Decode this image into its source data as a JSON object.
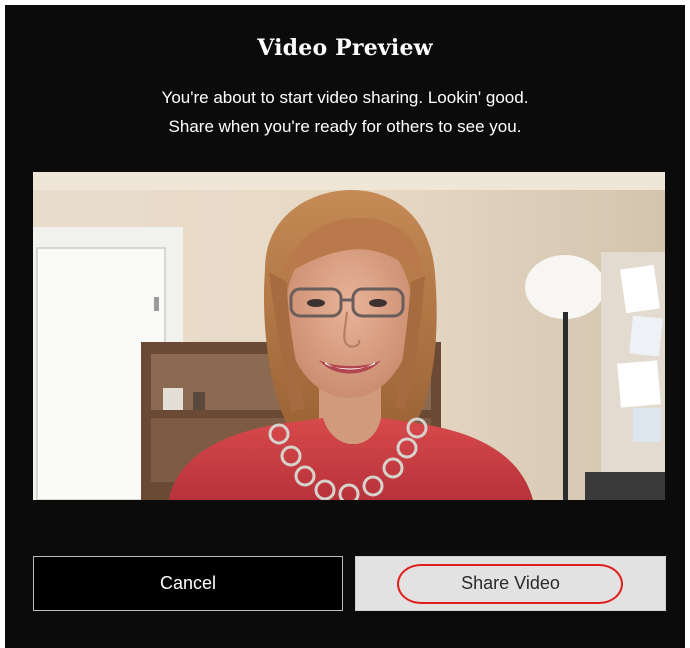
{
  "dialog": {
    "title": "Video Preview",
    "message_line1": "You're about to start video sharing. Lookin' good.",
    "message_line2": "Share when you're ready for others to see you."
  },
  "buttons": {
    "cancel_label": "Cancel",
    "share_label": "Share Video"
  },
  "colors": {
    "background": "#0b0b0b",
    "text": "#ffffff",
    "cancel_border": "#bdbdbd",
    "share_background": "#e2e2e2",
    "highlight_annotation": "#e02020"
  }
}
